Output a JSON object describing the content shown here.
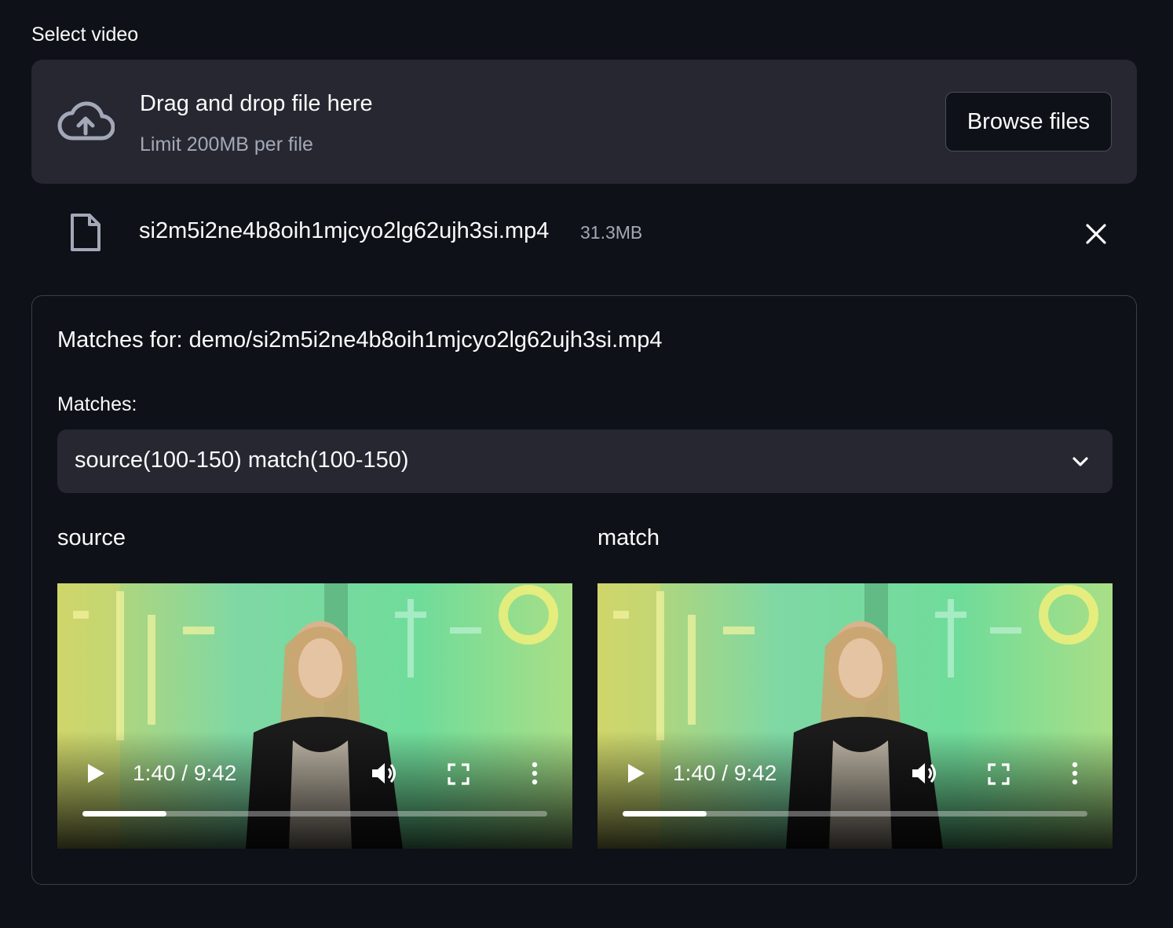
{
  "uploader": {
    "label": "Select video",
    "title": "Drag and drop file here",
    "limit": "Limit 200MB per file",
    "browse_label": "Browse files"
  },
  "file": {
    "name": "si2m5i2ne4b8oih1mjcyo2lg62ujh3si.mp4",
    "size": "31.3MB"
  },
  "panel": {
    "title": "Matches for: demo/si2m5i2ne4b8oih1mjcyo2lg62ujh3si.mp4",
    "select_label": "Matches:",
    "selected": "source(100-150) match(100-150)"
  },
  "videos": [
    {
      "title": "source",
      "time": "1:40 / 9:42",
      "progress": 0.18
    },
    {
      "title": "match",
      "time": "1:40 / 9:42",
      "progress": 0.18
    }
  ],
  "icons": {
    "upload": "cloud-upload-icon",
    "file": "file-icon",
    "remove": "close-icon",
    "dropdown": "chevron-down-icon",
    "play": "play-icon",
    "volume": "volume-icon",
    "fullscreen": "fullscreen-icon",
    "more": "more-vert-icon"
  },
  "colors": {
    "background": "#0e1117",
    "surface": "#262730",
    "text": "#fafafa",
    "muted": "#a3a8b8"
  }
}
